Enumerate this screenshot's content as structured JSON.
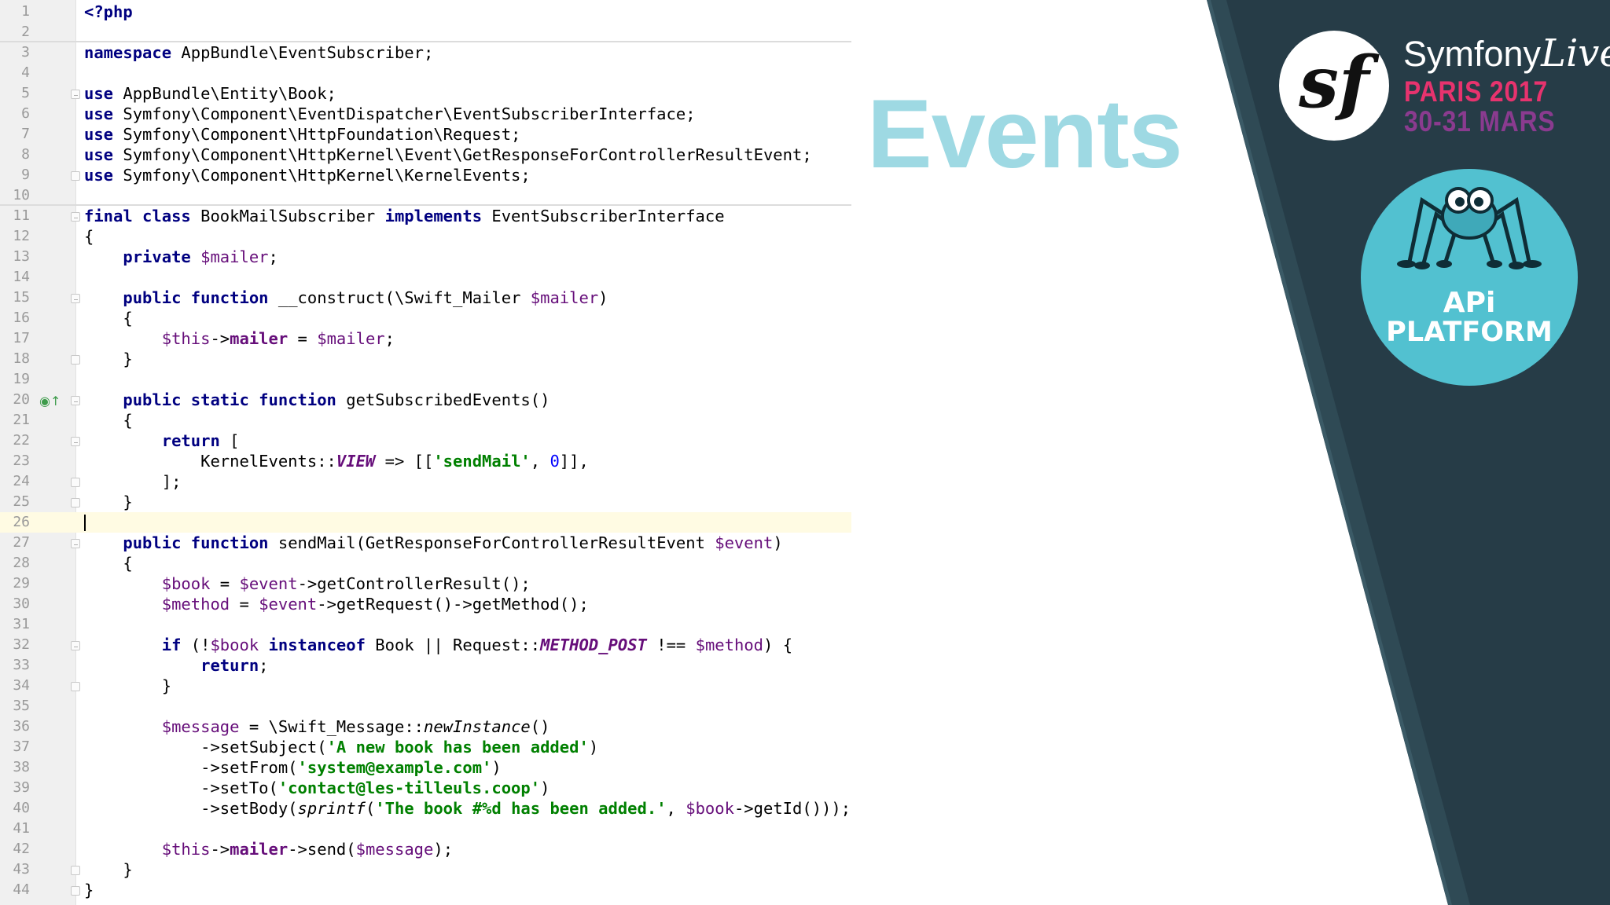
{
  "slide": {
    "title": "Events"
  },
  "branding": {
    "symfony_live": {
      "name_main": "Symfony",
      "name_script": "Live",
      "city_year": "PARIS 2017",
      "dates": "30-31 MARS"
    },
    "api_platform": {
      "line1": "APi",
      "line2": "PLATFORM"
    },
    "colors": {
      "panel_dark": "#243944",
      "panel_mid": "#2f4a55",
      "title_cyan": "#9ed9e3",
      "city_pink": "#e7336e",
      "dates_purple": "#8a3b8f",
      "api_cyan": "#52c1d0"
    }
  },
  "editor": {
    "current_line": 26,
    "lines": [
      {
        "n": "1",
        "tokens": [
          [
            "kw",
            "<?php"
          ]
        ]
      },
      {
        "n": "2",
        "tokens": [],
        "sep": true
      },
      {
        "n": "3",
        "tokens": [
          [
            "kw",
            "namespace"
          ],
          [
            "p",
            " AppBundle\\EventSubscriber;"
          ]
        ]
      },
      {
        "n": "4",
        "tokens": []
      },
      {
        "n": "5",
        "tokens": [
          [
            "kw",
            "use"
          ],
          [
            "p",
            " AppBundle\\Entity\\Book;"
          ]
        ],
        "fold": "open"
      },
      {
        "n": "6",
        "tokens": [
          [
            "kw",
            "use"
          ],
          [
            "p",
            " Symfony\\Component\\EventDispatcher\\EventSubscriberInterface;"
          ]
        ]
      },
      {
        "n": "7",
        "tokens": [
          [
            "kw",
            "use"
          ],
          [
            "p",
            " Symfony\\Component\\HttpFoundation\\Request;"
          ]
        ]
      },
      {
        "n": "8",
        "tokens": [
          [
            "kw",
            "use"
          ],
          [
            "p",
            " Symfony\\Component\\HttpKernel\\Event\\GetResponseForControllerResultEvent;"
          ]
        ]
      },
      {
        "n": "9",
        "tokens": [
          [
            "kw",
            "use"
          ],
          [
            "p",
            " Symfony\\Component\\HttpKernel\\KernelEvents;"
          ]
        ],
        "fold": "close"
      },
      {
        "n": "10",
        "tokens": [],
        "sep": true
      },
      {
        "n": "11",
        "tokens": [
          [
            "kw",
            "final class"
          ],
          [
            "p",
            " BookMailSubscriber "
          ],
          [
            "kw",
            "implements"
          ],
          [
            "p",
            " EventSubscriberInterface"
          ]
        ],
        "fold": "open"
      },
      {
        "n": "12",
        "tokens": [
          [
            "p",
            "{"
          ]
        ]
      },
      {
        "n": "13",
        "tokens": [
          [
            "p",
            "    "
          ],
          [
            "kw",
            "private"
          ],
          [
            "p",
            " "
          ],
          [
            "var",
            "$mailer"
          ],
          [
            "p",
            ";"
          ]
        ]
      },
      {
        "n": "14",
        "tokens": []
      },
      {
        "n": "15",
        "tokens": [
          [
            "p",
            "    "
          ],
          [
            "kw",
            "public function"
          ],
          [
            "p",
            " __construct(\\Swift_Mailer "
          ],
          [
            "var",
            "$mailer"
          ],
          [
            "p",
            ")"
          ]
        ],
        "fold": "open"
      },
      {
        "n": "16",
        "tokens": [
          [
            "p",
            "    {"
          ]
        ]
      },
      {
        "n": "17",
        "tokens": [
          [
            "p",
            "        "
          ],
          [
            "var",
            "$this"
          ],
          [
            "p",
            "->"
          ],
          [
            "prop",
            "mailer"
          ],
          [
            "p",
            " = "
          ],
          [
            "var",
            "$mailer"
          ],
          [
            "p",
            ";"
          ]
        ]
      },
      {
        "n": "18",
        "tokens": [
          [
            "p",
            "    }"
          ]
        ],
        "fold": "close"
      },
      {
        "n": "19",
        "tokens": []
      },
      {
        "n": "20",
        "tokens": [
          [
            "p",
            "    "
          ],
          [
            "kw",
            "public static function"
          ],
          [
            "p",
            " getSubscribedEvents()"
          ]
        ],
        "fold": "open",
        "icon": "override-icon"
      },
      {
        "n": "21",
        "tokens": [
          [
            "p",
            "    {"
          ]
        ]
      },
      {
        "n": "22",
        "tokens": [
          [
            "p",
            "        "
          ],
          [
            "kw",
            "return"
          ],
          [
            "p",
            " ["
          ]
        ],
        "fold": "open"
      },
      {
        "n": "23",
        "tokens": [
          [
            "p",
            "            KernelEvents::"
          ],
          [
            "const",
            "VIEW"
          ],
          [
            "p",
            " => [["
          ],
          [
            "str",
            "'sendMail'"
          ],
          [
            "p",
            ", "
          ],
          [
            "num",
            "0"
          ],
          [
            "p",
            "]],"
          ]
        ]
      },
      {
        "n": "24",
        "tokens": [
          [
            "p",
            "        ];"
          ]
        ],
        "fold": "close"
      },
      {
        "n": "25",
        "tokens": [
          [
            "p",
            "    }"
          ]
        ],
        "fold": "close"
      },
      {
        "n": "26",
        "tokens": [],
        "current": true
      },
      {
        "n": "27",
        "tokens": [
          [
            "p",
            "    "
          ],
          [
            "kw",
            "public function"
          ],
          [
            "p",
            " sendMail(GetResponseForControllerResultEvent "
          ],
          [
            "var",
            "$event"
          ],
          [
            "p",
            ")"
          ]
        ],
        "fold": "open"
      },
      {
        "n": "28",
        "tokens": [
          [
            "p",
            "    {"
          ]
        ]
      },
      {
        "n": "29",
        "tokens": [
          [
            "p",
            "        "
          ],
          [
            "var",
            "$book"
          ],
          [
            "p",
            " = "
          ],
          [
            "var",
            "$event"
          ],
          [
            "p",
            "->getControllerResult();"
          ]
        ]
      },
      {
        "n": "30",
        "tokens": [
          [
            "p",
            "        "
          ],
          [
            "var",
            "$method"
          ],
          [
            "p",
            " = "
          ],
          [
            "var",
            "$event"
          ],
          [
            "p",
            "->getRequest()->getMethod();"
          ]
        ]
      },
      {
        "n": "31",
        "tokens": []
      },
      {
        "n": "32",
        "tokens": [
          [
            "p",
            "        "
          ],
          [
            "kw",
            "if"
          ],
          [
            "p",
            " (!"
          ],
          [
            "var",
            "$book"
          ],
          [
            "p",
            " "
          ],
          [
            "kw",
            "instanceof"
          ],
          [
            "p",
            " Book || Request::"
          ],
          [
            "const",
            "METHOD_POST"
          ],
          [
            "p",
            " !== "
          ],
          [
            "var",
            "$method"
          ],
          [
            "p",
            ") {"
          ]
        ],
        "fold": "open"
      },
      {
        "n": "33",
        "tokens": [
          [
            "p",
            "            "
          ],
          [
            "kw",
            "return"
          ],
          [
            "p",
            ";"
          ]
        ]
      },
      {
        "n": "34",
        "tokens": [
          [
            "p",
            "        }"
          ]
        ],
        "fold": "close"
      },
      {
        "n": "35",
        "tokens": []
      },
      {
        "n": "36",
        "tokens": [
          [
            "p",
            "        "
          ],
          [
            "var",
            "$message"
          ],
          [
            "p",
            " = \\Swift_Message::"
          ],
          [
            "ital",
            "newInstance"
          ],
          [
            "p",
            "()"
          ]
        ]
      },
      {
        "n": "37",
        "tokens": [
          [
            "p",
            "            ->setSubject("
          ],
          [
            "str",
            "'A new book has been added'"
          ],
          [
            "p",
            ")"
          ]
        ]
      },
      {
        "n": "38",
        "tokens": [
          [
            "p",
            "            ->setFrom("
          ],
          [
            "str",
            "'system@example.com'"
          ],
          [
            "p",
            ")"
          ]
        ]
      },
      {
        "n": "39",
        "tokens": [
          [
            "p",
            "            ->setTo("
          ],
          [
            "str",
            "'contact@les-tilleuls.coop'"
          ],
          [
            "p",
            ")"
          ]
        ]
      },
      {
        "n": "40",
        "tokens": [
          [
            "p",
            "            ->setBody("
          ],
          [
            "ital",
            "sprintf"
          ],
          [
            "p",
            "("
          ],
          [
            "str",
            "'The book #%d has been added.'"
          ],
          [
            "p",
            ", "
          ],
          [
            "var",
            "$book"
          ],
          [
            "p",
            "->getId()));"
          ]
        ]
      },
      {
        "n": "41",
        "tokens": []
      },
      {
        "n": "42",
        "tokens": [
          [
            "p",
            "        "
          ],
          [
            "var",
            "$this"
          ],
          [
            "p",
            "->"
          ],
          [
            "prop",
            "mailer"
          ],
          [
            "p",
            "->send("
          ],
          [
            "var",
            "$message"
          ],
          [
            "p",
            ");"
          ]
        ]
      },
      {
        "n": "43",
        "tokens": [
          [
            "p",
            "    }"
          ]
        ],
        "fold": "close"
      },
      {
        "n": "44",
        "tokens": [
          [
            "p",
            "}"
          ]
        ],
        "fold": "close"
      }
    ]
  }
}
